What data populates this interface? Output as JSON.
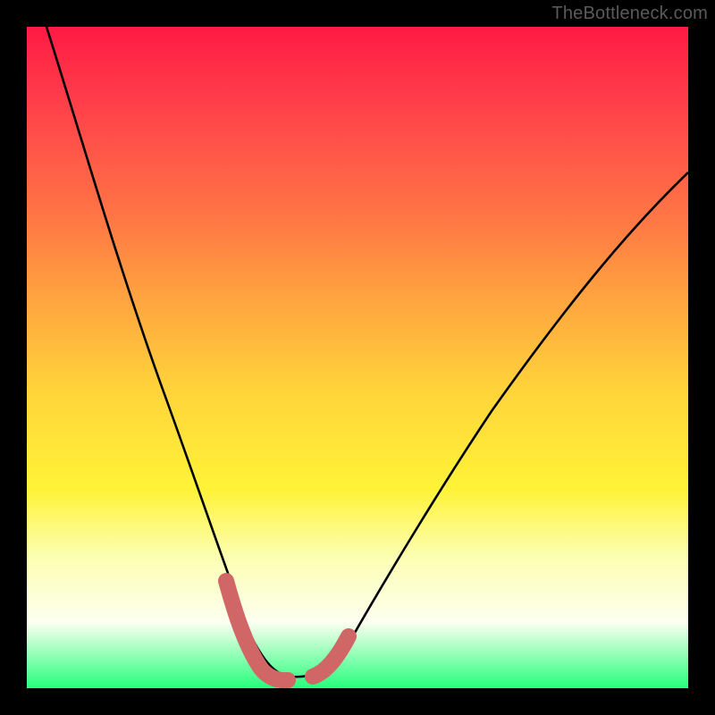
{
  "watermark": {
    "text": "TheBottleneck.com"
  },
  "chart_data": {
    "type": "line",
    "title": "",
    "xlabel": "",
    "ylabel": "",
    "xlim": [
      0,
      100
    ],
    "ylim": [
      0,
      100
    ],
    "grid": false,
    "series": [
      {
        "name": "bottleneck-curve",
        "x": [
          3,
          6,
          9,
          12,
          15,
          18,
          21,
          24,
          27,
          30,
          32,
          34,
          37,
          40,
          45,
          50,
          55,
          60,
          65,
          70,
          75,
          80,
          85,
          90,
          95,
          100
        ],
        "values": [
          100,
          90,
          80,
          71,
          62,
          53,
          45,
          37,
          29,
          22,
          15,
          9,
          4,
          2,
          2,
          4,
          9,
          16,
          23,
          30,
          37,
          44,
          50,
          56,
          61,
          65
        ]
      }
    ],
    "band_markers": [
      {
        "name": "left-marker",
        "x_start": 30,
        "x_end": 37
      },
      {
        "name": "right-marker",
        "x_start": 43,
        "x_end": 48
      }
    ],
    "background": {
      "type": "vertical-gradient",
      "stops": [
        {
          "pos": 0,
          "color": "#ff1a44"
        },
        {
          "pos": 40,
          "color": "#ffa040"
        },
        {
          "pos": 70,
          "color": "#fff338"
        },
        {
          "pos": 90,
          "color": "#fdfff0"
        },
        {
          "pos": 100,
          "color": "#25ff7c"
        }
      ]
    }
  }
}
